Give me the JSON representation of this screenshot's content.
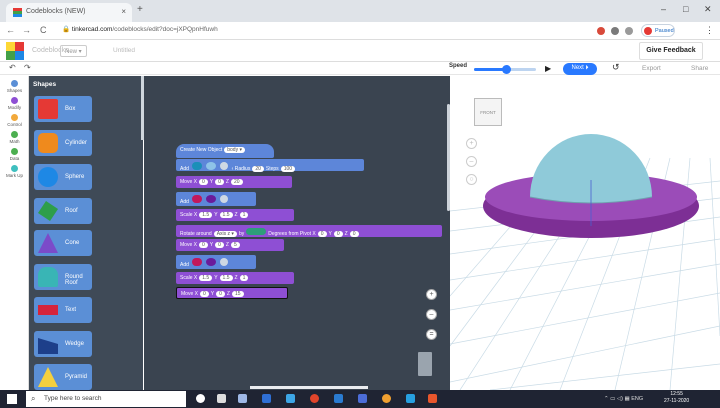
{
  "browser": {
    "tab_title": "Codeblocks (NEW)",
    "tab_close": "×",
    "new_tab": "+",
    "url_domain": "tinkercad.com",
    "url_path": "/codeblocks/edit?doc=jXPQpnHfuwh",
    "url_prefix": "",
    "profile_label": "Paused",
    "window_min": "–",
    "window_max": "□",
    "window_close": "✕",
    "nav_back": "←",
    "nav_forward": "→",
    "nav_reload": "C",
    "menu": "⋮"
  },
  "app": {
    "name": "Codeblocks",
    "new_label": "New ▾",
    "doc_title": "Untitled",
    "feedback": "Give Feedback",
    "undo": "↶",
    "redo": "↷",
    "speed_label": "Speed",
    "speed_level": 0.52,
    "play": "▶",
    "next_label": "Next ⏵",
    "reset": "↺",
    "export": "Export",
    "share": "Share"
  },
  "categories": [
    {
      "label": "Shapes",
      "color": "#5b8fd6"
    },
    {
      "label": "Modify",
      "color": "#8e4fd4"
    },
    {
      "label": "Control",
      "color": "#f2a93b"
    },
    {
      "label": "Math",
      "color": "#4caf50"
    },
    {
      "label": "Data",
      "color": "#4caf50"
    },
    {
      "label": "Mark Up",
      "color": "#3fbfbf"
    }
  ],
  "flyout": {
    "title": "Shapes",
    "items": [
      {
        "label": "Box",
        "color": "#e53935"
      },
      {
        "label": "Cylinder",
        "color": "#ef8a1d"
      },
      {
        "label": "Sphere",
        "color": "#1e88e5"
      },
      {
        "label": "Roof",
        "color": "#2e9e4a"
      },
      {
        "label": "Cone",
        "color": "#7b4bc9"
      },
      {
        "label": "Round Roof",
        "color": "#39b5b5"
      },
      {
        "label": "Text",
        "color": "#d6243a"
      },
      {
        "label": "Wedge",
        "color": "#1d3f8a"
      },
      {
        "label": "Pyramid",
        "color": "#f4d03f"
      }
    ]
  },
  "blocks": {
    "hat": "Create New Object",
    "hat_value": "body ▾",
    "add1": {
      "label": "Add",
      "radius_label": "Radius",
      "radius": "20",
      "steps_label": "Steps",
      "steps": "100"
    },
    "move1": {
      "label": "Move",
      "x_label": "X",
      "x": "0",
      "y_label": "Y",
      "y": "0",
      "z_label": "Z",
      "z": "20"
    },
    "add2": {
      "label": "Add"
    },
    "scale1": {
      "label": "Scale",
      "x_label": "X",
      "x": "1.5",
      "y_label": "Y",
      "y": "1.5",
      "z_label": "Z",
      "z": "1"
    },
    "rotate": {
      "label": "Rotate around",
      "axis": "Axis z ▾",
      "by": "by",
      "degrees_label": "Degrees",
      "from_pivot": "from Pivot",
      "x_label": "X",
      "x": "0",
      "y_label": "Y",
      "y": "0",
      "z_label": "Z",
      "z": "0"
    },
    "move2": {
      "label": "Move",
      "x_label": "X",
      "x": "0",
      "y_label": "Y",
      "y": "0",
      "z_label": "Z",
      "z": "5"
    },
    "add3": {
      "label": "Add"
    },
    "scale2": {
      "label": "Scale",
      "x_label": "X",
      "x": "1.5",
      "y_label": "Y",
      "y": "1.5",
      "z_label": "Z",
      "z": "1"
    },
    "move3": {
      "label": "Move",
      "x_label": "X",
      "x": "0",
      "y_label": "Y",
      "y": "0",
      "z_label": "Z",
      "z": "15"
    }
  },
  "workspace": {
    "zoom_in": "+",
    "zoom_out": "–",
    "zoom_reset": "="
  },
  "viewport": {
    "view_cube": "FRONT",
    "ctrl1": "+",
    "ctrl2": "–",
    "ctrl3": "○",
    "dome_color": "#8fcad9",
    "saucer_color": "#8b3fa6"
  },
  "taskbar": {
    "search_placeholder": "Type here to search",
    "language": "ENG",
    "time": "12:55",
    "date": "27-11-2020"
  }
}
